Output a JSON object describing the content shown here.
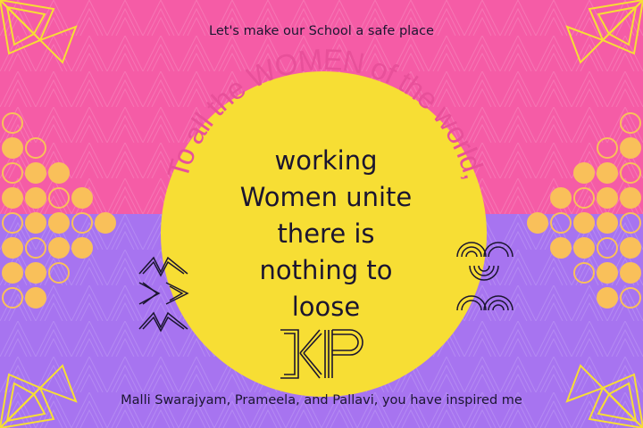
{
  "tagline": "Let's make our School a safe place",
  "arc_text": "To all the WOMEN of the world,",
  "message_lines": [
    "working",
    "Women unite",
    "there is",
    "nothing to",
    "loose"
  ],
  "footer": "Malli Swarajyam, Prameela, and Pallavi, you have inspired me",
  "colors": {
    "top_band": "#f55ca6",
    "bottom_band": "#a774f0",
    "sun": "#f7de34",
    "arc_text": "#e8509a",
    "circles": "#f9c05a",
    "ink": "#1b1530"
  },
  "decorations": [
    "corner-flower-top-left",
    "corner-flower-top-right",
    "corner-flower-bottom-left",
    "corner-flower-bottom-right",
    "circle-cluster-left",
    "circle-cluster-right",
    "zigzag-arrows-icon",
    "semicircle-stack-icon",
    "kp-monogram-logo"
  ]
}
